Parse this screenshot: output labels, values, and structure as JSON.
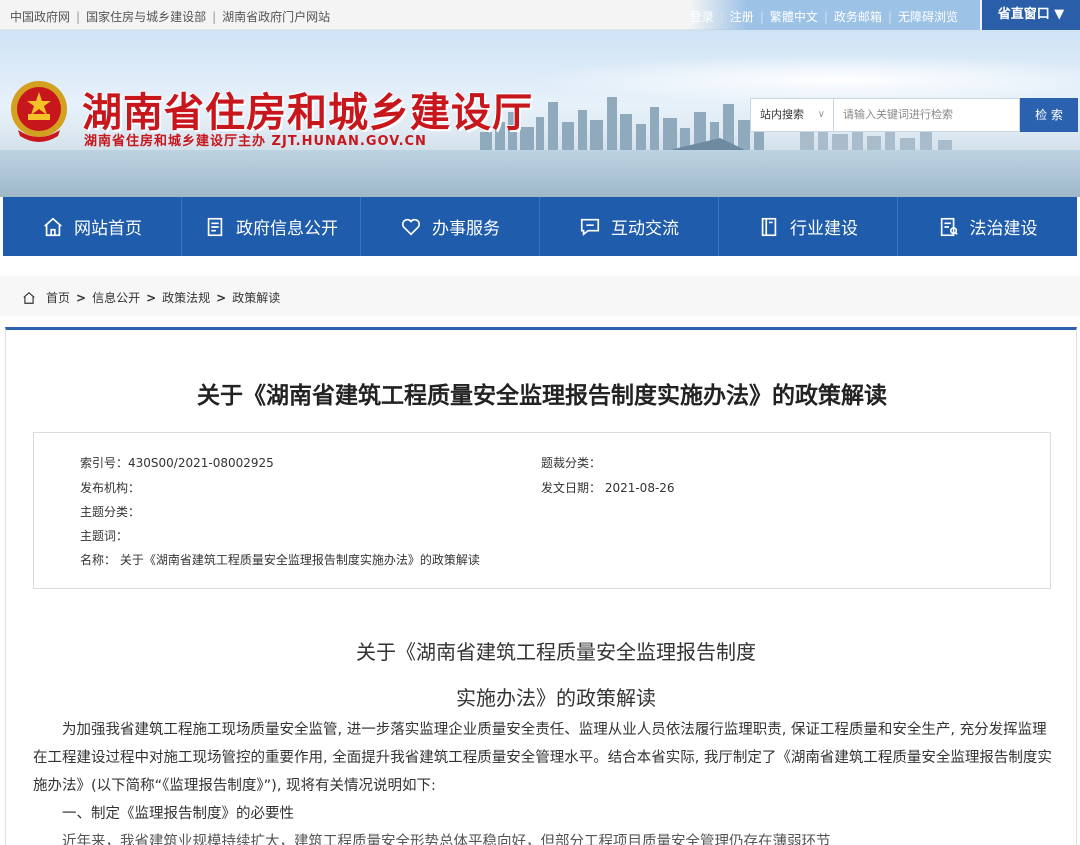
{
  "topbar": {
    "links_left": [
      "中国政府网",
      "国家住房与城乡建设部",
      "湖南省政府门户网站"
    ],
    "links_right": [
      "登录",
      "注册",
      "繁體中文",
      "政务邮箱",
      "无障碍浏览"
    ],
    "window_label": "省直窗口 ▼"
  },
  "banner": {
    "title": "湖南省住房和城乡建设厅",
    "subtitle": "湖南省住房和城乡建设厅主办  ZJT.HUNAN.GOV.CN"
  },
  "search": {
    "scope": "站内搜索",
    "placeholder": "请输入关键词进行检索",
    "button": "检 索"
  },
  "nav": [
    {
      "label": "网站首页",
      "icon": "home-icon"
    },
    {
      "label": "政府信息公开",
      "icon": "document-icon"
    },
    {
      "label": "办事服务",
      "icon": "heart-icon"
    },
    {
      "label": "互动交流",
      "icon": "chat-icon"
    },
    {
      "label": "行业建设",
      "icon": "book-icon"
    },
    {
      "label": "法治建设",
      "icon": "law-icon"
    }
  ],
  "breadcrumb": [
    "首页",
    "信息公开",
    "政策法规",
    "政策解读"
  ],
  "article": {
    "title": "关于《湖南省建筑工程质量安全监理报告制度实施办法》的政策解读",
    "meta": {
      "index": "索引号：430S00/2021-08002925",
      "genre": "题裁分类：",
      "publisher": "发布机构：",
      "date": "发文日期： 2021-08-26",
      "topic": "主题分类：",
      "keywords": "主题词：",
      "name": "名称： 关于《湖南省建筑工程质量安全监理报告制度实施办法》的政策解读"
    },
    "heading_line1": "关于《湖南省建筑工程质量安全监理报告制度",
    "heading_line2": "实施办法》的政策解读",
    "paragraph1": "为加强我省建筑工程施工现场质量安全监管, 进一步落实监理企业质量安全责任、监理从业人员依法履行监理职责, 保证工程质量和安全生产, 充分发挥监理在工程建设过程中对施工现场管控的重要作用, 全面提升我省建筑工程质量安全管理水平。结合本省实际, 我厅制定了《湖南省建筑工程质量安全监理报告制度实施办法》(以下简称“《监理报告制度》”), 现将有关情况说明如下:",
    "paragraph2": "一、制定《监理报告制度》的必要性",
    "paragraph3": "近年来，我省建筑业规模持续扩大，建筑工程质量安全形势总体平稳向好，但部分工程项目质量安全管理仍存在薄弱环节"
  }
}
